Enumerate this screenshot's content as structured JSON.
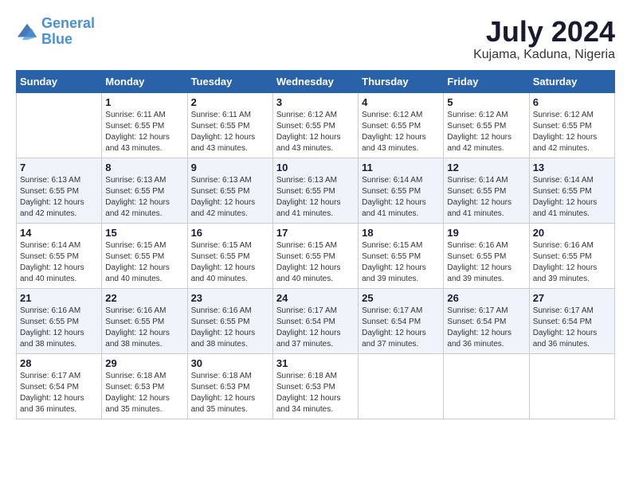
{
  "header": {
    "logo_line1": "General",
    "logo_line2": "Blue",
    "month_year": "July 2024",
    "location": "Kujama, Kaduna, Nigeria"
  },
  "days_of_week": [
    "Sunday",
    "Monday",
    "Tuesday",
    "Wednesday",
    "Thursday",
    "Friday",
    "Saturday"
  ],
  "weeks": [
    [
      {
        "day": "",
        "sunrise": "",
        "sunset": "",
        "daylight": ""
      },
      {
        "day": "1",
        "sunrise": "Sunrise: 6:11 AM",
        "sunset": "Sunset: 6:55 PM",
        "daylight": "Daylight: 12 hours and 43 minutes."
      },
      {
        "day": "2",
        "sunrise": "Sunrise: 6:11 AM",
        "sunset": "Sunset: 6:55 PM",
        "daylight": "Daylight: 12 hours and 43 minutes."
      },
      {
        "day": "3",
        "sunrise": "Sunrise: 6:12 AM",
        "sunset": "Sunset: 6:55 PM",
        "daylight": "Daylight: 12 hours and 43 minutes."
      },
      {
        "day": "4",
        "sunrise": "Sunrise: 6:12 AM",
        "sunset": "Sunset: 6:55 PM",
        "daylight": "Daylight: 12 hours and 43 minutes."
      },
      {
        "day": "5",
        "sunrise": "Sunrise: 6:12 AM",
        "sunset": "Sunset: 6:55 PM",
        "daylight": "Daylight: 12 hours and 42 minutes."
      },
      {
        "day": "6",
        "sunrise": "Sunrise: 6:12 AM",
        "sunset": "Sunset: 6:55 PM",
        "daylight": "Daylight: 12 hours and 42 minutes."
      }
    ],
    [
      {
        "day": "7",
        "sunrise": "Sunrise: 6:13 AM",
        "sunset": "Sunset: 6:55 PM",
        "daylight": "Daylight: 12 hours and 42 minutes."
      },
      {
        "day": "8",
        "sunrise": "Sunrise: 6:13 AM",
        "sunset": "Sunset: 6:55 PM",
        "daylight": "Daylight: 12 hours and 42 minutes."
      },
      {
        "day": "9",
        "sunrise": "Sunrise: 6:13 AM",
        "sunset": "Sunset: 6:55 PM",
        "daylight": "Daylight: 12 hours and 42 minutes."
      },
      {
        "day": "10",
        "sunrise": "Sunrise: 6:13 AM",
        "sunset": "Sunset: 6:55 PM",
        "daylight": "Daylight: 12 hours and 41 minutes."
      },
      {
        "day": "11",
        "sunrise": "Sunrise: 6:14 AM",
        "sunset": "Sunset: 6:55 PM",
        "daylight": "Daylight: 12 hours and 41 minutes."
      },
      {
        "day": "12",
        "sunrise": "Sunrise: 6:14 AM",
        "sunset": "Sunset: 6:55 PM",
        "daylight": "Daylight: 12 hours and 41 minutes."
      },
      {
        "day": "13",
        "sunrise": "Sunrise: 6:14 AM",
        "sunset": "Sunset: 6:55 PM",
        "daylight": "Daylight: 12 hours and 41 minutes."
      }
    ],
    [
      {
        "day": "14",
        "sunrise": "Sunrise: 6:14 AM",
        "sunset": "Sunset: 6:55 PM",
        "daylight": "Daylight: 12 hours and 40 minutes."
      },
      {
        "day": "15",
        "sunrise": "Sunrise: 6:15 AM",
        "sunset": "Sunset: 6:55 PM",
        "daylight": "Daylight: 12 hours and 40 minutes."
      },
      {
        "day": "16",
        "sunrise": "Sunrise: 6:15 AM",
        "sunset": "Sunset: 6:55 PM",
        "daylight": "Daylight: 12 hours and 40 minutes."
      },
      {
        "day": "17",
        "sunrise": "Sunrise: 6:15 AM",
        "sunset": "Sunset: 6:55 PM",
        "daylight": "Daylight: 12 hours and 40 minutes."
      },
      {
        "day": "18",
        "sunrise": "Sunrise: 6:15 AM",
        "sunset": "Sunset: 6:55 PM",
        "daylight": "Daylight: 12 hours and 39 minutes."
      },
      {
        "day": "19",
        "sunrise": "Sunrise: 6:16 AM",
        "sunset": "Sunset: 6:55 PM",
        "daylight": "Daylight: 12 hours and 39 minutes."
      },
      {
        "day": "20",
        "sunrise": "Sunrise: 6:16 AM",
        "sunset": "Sunset: 6:55 PM",
        "daylight": "Daylight: 12 hours and 39 minutes."
      }
    ],
    [
      {
        "day": "21",
        "sunrise": "Sunrise: 6:16 AM",
        "sunset": "Sunset: 6:55 PM",
        "daylight": "Daylight: 12 hours and 38 minutes."
      },
      {
        "day": "22",
        "sunrise": "Sunrise: 6:16 AM",
        "sunset": "Sunset: 6:55 PM",
        "daylight": "Daylight: 12 hours and 38 minutes."
      },
      {
        "day": "23",
        "sunrise": "Sunrise: 6:16 AM",
        "sunset": "Sunset: 6:55 PM",
        "daylight": "Daylight: 12 hours and 38 minutes."
      },
      {
        "day": "24",
        "sunrise": "Sunrise: 6:17 AM",
        "sunset": "Sunset: 6:54 PM",
        "daylight": "Daylight: 12 hours and 37 minutes."
      },
      {
        "day": "25",
        "sunrise": "Sunrise: 6:17 AM",
        "sunset": "Sunset: 6:54 PM",
        "daylight": "Daylight: 12 hours and 37 minutes."
      },
      {
        "day": "26",
        "sunrise": "Sunrise: 6:17 AM",
        "sunset": "Sunset: 6:54 PM",
        "daylight": "Daylight: 12 hours and 36 minutes."
      },
      {
        "day": "27",
        "sunrise": "Sunrise: 6:17 AM",
        "sunset": "Sunset: 6:54 PM",
        "daylight": "Daylight: 12 hours and 36 minutes."
      }
    ],
    [
      {
        "day": "28",
        "sunrise": "Sunrise: 6:17 AM",
        "sunset": "Sunset: 6:54 PM",
        "daylight": "Daylight: 12 hours and 36 minutes."
      },
      {
        "day": "29",
        "sunrise": "Sunrise: 6:18 AM",
        "sunset": "Sunset: 6:53 PM",
        "daylight": "Daylight: 12 hours and 35 minutes."
      },
      {
        "day": "30",
        "sunrise": "Sunrise: 6:18 AM",
        "sunset": "Sunset: 6:53 PM",
        "daylight": "Daylight: 12 hours and 35 minutes."
      },
      {
        "day": "31",
        "sunrise": "Sunrise: 6:18 AM",
        "sunset": "Sunset: 6:53 PM",
        "daylight": "Daylight: 12 hours and 34 minutes."
      },
      {
        "day": "",
        "sunrise": "",
        "sunset": "",
        "daylight": ""
      },
      {
        "day": "",
        "sunrise": "",
        "sunset": "",
        "daylight": ""
      },
      {
        "day": "",
        "sunrise": "",
        "sunset": "",
        "daylight": ""
      }
    ]
  ]
}
